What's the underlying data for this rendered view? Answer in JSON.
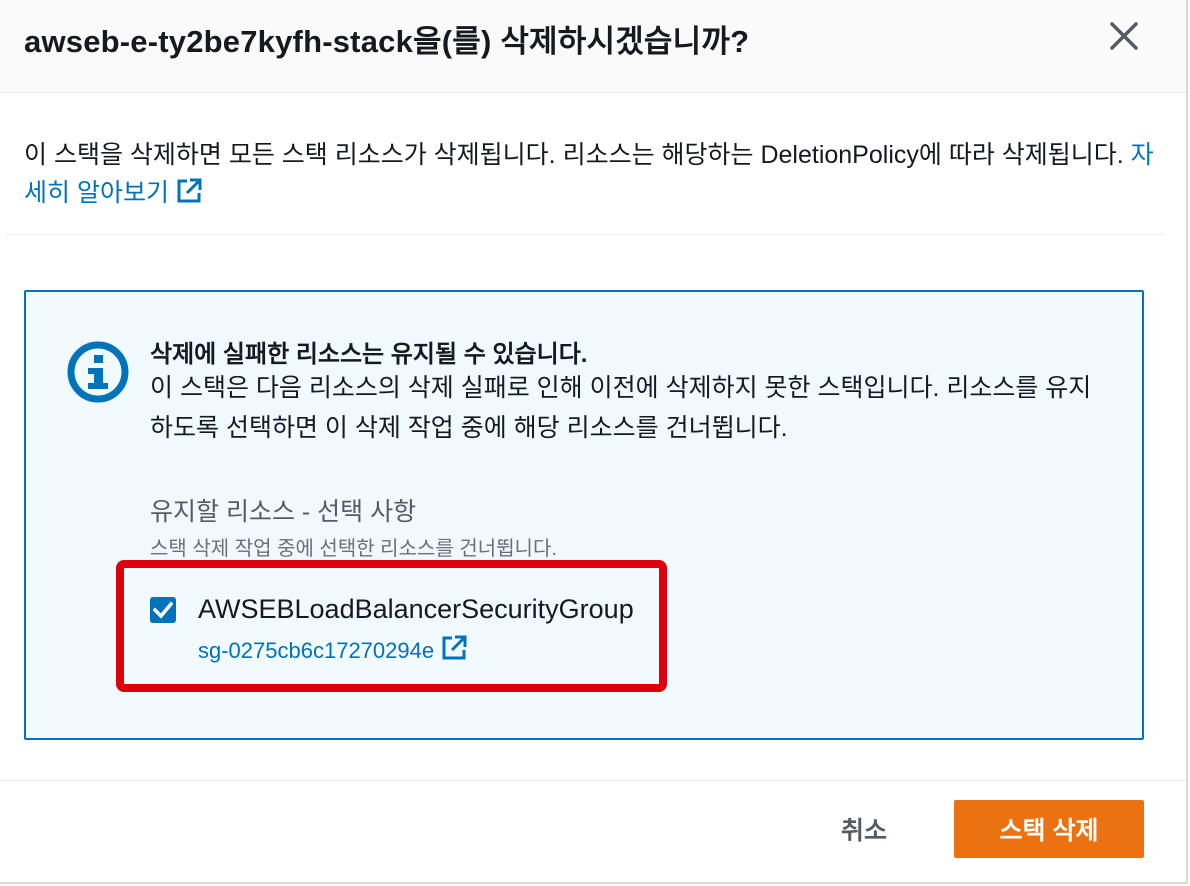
{
  "dialog": {
    "title": "awseb-e-ty2be7kyfh-stack을(를) 삭제하시겠습니까?",
    "close_icon": "close-icon"
  },
  "intro": {
    "text": "이 스택을 삭제하면 모든 스택 리소스가 삭제됩니다. 리소스는 해당하는 DeletionPolicy에 따라 삭제됩니다.",
    "learn_more_label": "자세히 알아보기",
    "learn_more_icon": "external-link-icon"
  },
  "info_alert": {
    "icon": "info-icon",
    "title": "삭제에 실패한 리소스는 유지될 수 있습니다.",
    "body": "이 스택은 다음 리소스의 삭제 실패로 인해 이전에 삭제하지 못한 스택입니다. 리소스를 유지하도록 선택하면 이 삭제 작업 중에 해당 리소스를 건너뜁니다.",
    "field_label": "유지할 리소스 - 선택 사항",
    "field_description": "스택 삭제 작업 중에 선택한 리소스를 건너뜁니다.",
    "resources": [
      {
        "name": "AWSEBLoadBalancerSecurityGroup",
        "physical_id": "sg-0275cb6c17270294e",
        "checked": true
      }
    ]
  },
  "footer": {
    "cancel_label": "취소",
    "delete_label": "스택 삭제"
  },
  "colors": {
    "link": "#0073bb",
    "primary_button": "#ec7211",
    "info_background": "#f1faff",
    "info_border": "#0073bb",
    "highlight": "#e0000d"
  }
}
